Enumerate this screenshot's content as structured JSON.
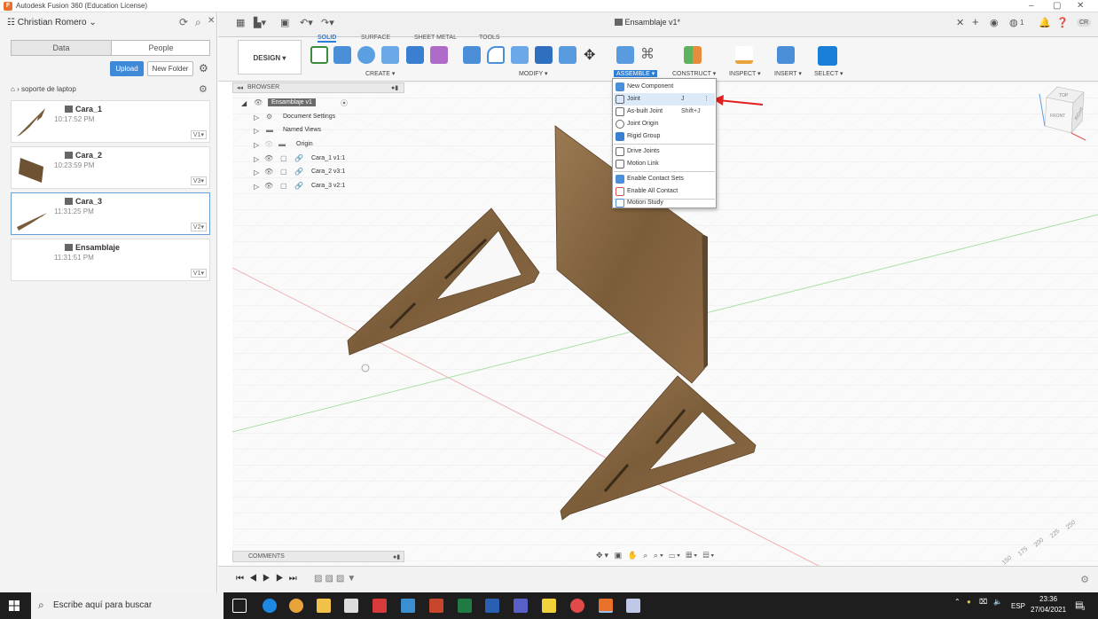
{
  "window": {
    "title": "Autodesk Fusion 360 (Education License)"
  },
  "data_panel": {
    "user": "Christian Romero",
    "tabs": [
      "Data",
      "People"
    ],
    "upload_label": "Upload",
    "new_folder_label": "New Folder",
    "breadcrumb": "soporte de laptop",
    "files": [
      {
        "name": "Cara_1",
        "time": "10:17:52 PM",
        "version": "V1"
      },
      {
        "name": "Cara_2",
        "time": "10:23:59 PM",
        "version": "V3"
      },
      {
        "name": "Cara_3",
        "time": "11:31:25 PM",
        "version": "V2"
      },
      {
        "name": "Ensamblaje",
        "time": "11:31:51 PM",
        "version": "V1"
      }
    ]
  },
  "app_bar": {
    "document_tab": "Ensamblaje v1*",
    "notification_count": "1",
    "user_initials": "CR"
  },
  "ribbon": {
    "workspace": "DESIGN",
    "tabs": [
      "SOLID",
      "SURFACE",
      "SHEET METAL",
      "TOOLS"
    ],
    "groups": [
      "CREATE",
      "MODIFY",
      "ASSEMBLE",
      "CONSTRUCT",
      "INSPECT",
      "INSERT",
      "SELECT"
    ]
  },
  "browser": {
    "header": "BROWSER",
    "root": "Ensamblaje v1",
    "items": [
      "Document Settings",
      "Named Views",
      "Origin",
      "Cara_1 v1:1",
      "Cara_2 v3:1",
      "Cara_3 v2:1"
    ]
  },
  "assemble_menu": {
    "items": [
      {
        "label": "New Component",
        "shortcut": ""
      },
      {
        "label": "Joint",
        "shortcut": "J"
      },
      {
        "label": "As-built Joint",
        "shortcut": "Shift+J"
      },
      {
        "label": "Joint Origin",
        "shortcut": ""
      },
      {
        "label": "Rigid Group",
        "shortcut": ""
      },
      {
        "label": "Drive Joints",
        "shortcut": ""
      },
      {
        "label": "Motion Link",
        "shortcut": ""
      },
      {
        "label": "Enable Contact Sets",
        "shortcut": ""
      },
      {
        "label": "Enable All Contact",
        "shortcut": ""
      },
      {
        "label": "Motion Study",
        "shortcut": ""
      }
    ]
  },
  "comments": {
    "label": "COMMENTS"
  },
  "viewcube": {
    "top": "TOP",
    "front": "FRONT",
    "right": "RIGHT"
  },
  "grid_labels": [
    "150",
    "175",
    "200",
    "225",
    "250"
  ],
  "taskbar": {
    "search_placeholder": "Escribe aquí para buscar",
    "language": "ESP",
    "time": "23:36",
    "date": "27/04/2021",
    "notifications": "3"
  },
  "colors": {
    "accent": "#2c7fd4",
    "wood": "#8a6a45",
    "arrow": "#e02020"
  }
}
